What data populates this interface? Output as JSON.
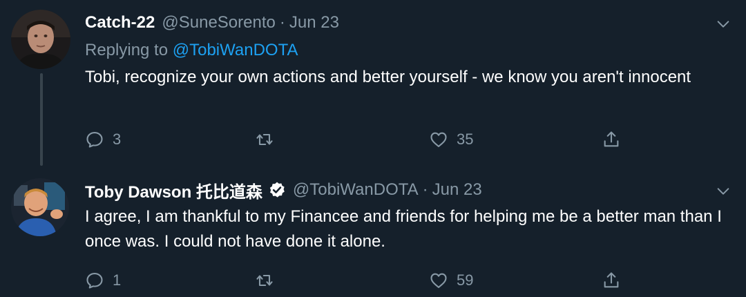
{
  "tweets": [
    {
      "display_name": "Catch-22",
      "verified": false,
      "handle": "@SuneSorento",
      "separator": "·",
      "date": "Jun 23",
      "replying_to_prefix": "Replying to",
      "replying_to_handle": "@TobiWanDOTA",
      "text": "Tobi, recognize your own actions and better yourself - we know you aren't innocent",
      "reply_count": "3",
      "retweet_count": "",
      "like_count": "35"
    },
    {
      "display_name": "Toby Dawson 托比道森",
      "verified": true,
      "handle": "@TobiWanDOTA",
      "separator": "·",
      "date": "Jun 23",
      "text": "I agree, I am thankful to my Financee and friends for helping me be a better man than I once was. I could not have done it alone.",
      "reply_count": "1",
      "retweet_count": "",
      "like_count": "59"
    }
  ],
  "icons": {
    "reply": "speech-bubble",
    "retweet": "retweet-arrows",
    "like": "heart-outline",
    "share": "share-upload",
    "more": "chevron-down",
    "verified": "verified-badge"
  },
  "colors": {
    "background": "#15202b",
    "secondary_text": "#8899a6",
    "link": "#1da1f2",
    "thread_line": "#38444d"
  }
}
